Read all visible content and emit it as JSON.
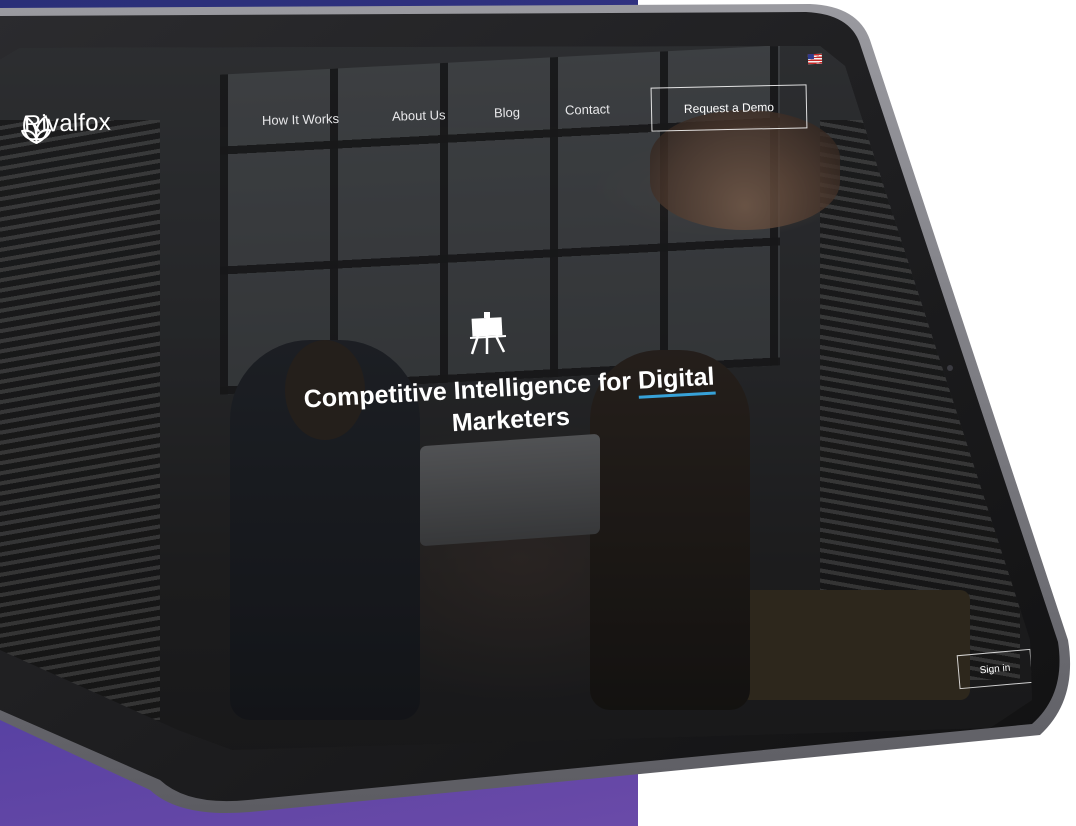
{
  "brand": {
    "name": "Rivalfox",
    "logo_icon": "leaf-logo-icon"
  },
  "nav": {
    "items": [
      {
        "label": "How It Works"
      },
      {
        "label": "About Us"
      },
      {
        "label": "Blog"
      },
      {
        "label": "Contact"
      }
    ],
    "cta_label": "Request a Demo",
    "locale_icon": "us-flag-icon"
  },
  "hero": {
    "icon": "easel-presentation-icon",
    "title_part1": "Competitive Intelligence for ",
    "title_highlight": "Digital",
    "title_part2": "Marketers",
    "highlight_color": "#37a2d8"
  },
  "footer": {
    "signin_label": "Sign in"
  },
  "colors": {
    "backdrop_start": "#2a2f78",
    "backdrop_end": "#6a4aa8",
    "device_frame": "#1b1b1d",
    "text": "#ffffff"
  }
}
